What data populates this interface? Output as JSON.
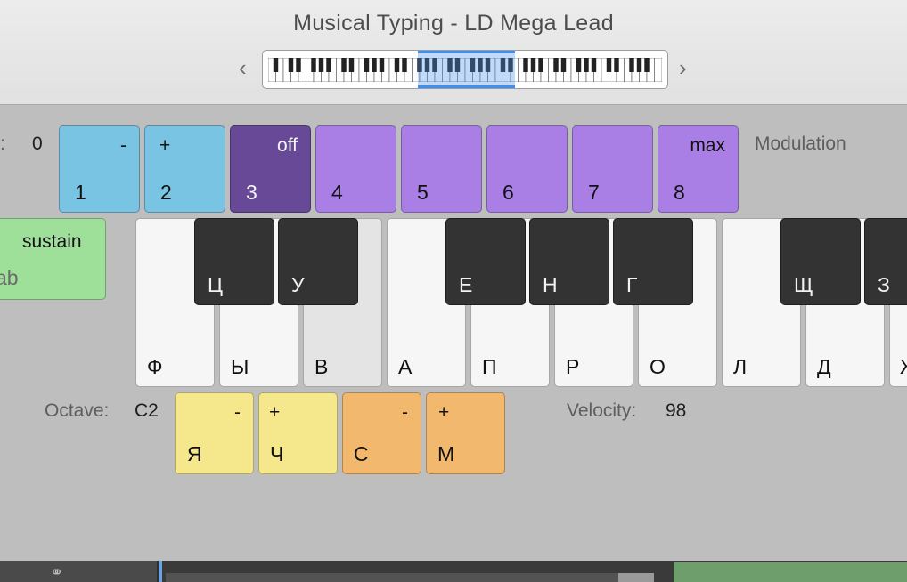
{
  "window": {
    "title": "Musical Typing - LD Mega Lead"
  },
  "navigation": {
    "prev_icon": "chevron-left-icon",
    "next_icon": "chevron-right-icon",
    "prev_glyph": "‹",
    "next_glyph": "›"
  },
  "pitch_bend": {
    "value": "0"
  },
  "pitch_keys": [
    {
      "symbol": "-",
      "key": "1"
    },
    {
      "symbol": "+",
      "key": "2"
    }
  ],
  "modulation_keys": [
    {
      "symbol": "off",
      "key": "3"
    },
    {
      "symbol": "",
      "key": "4"
    },
    {
      "symbol": "",
      "key": "5"
    },
    {
      "symbol": "",
      "key": "6"
    },
    {
      "symbol": "",
      "key": "7"
    },
    {
      "symbol": "max",
      "key": "8"
    }
  ],
  "modulation_label": "Modulation",
  "sustain": {
    "label": "sustain",
    "key": "ab"
  },
  "white_keys": [
    "Ф",
    "Ы",
    "В",
    "А",
    "П",
    "Р",
    "О",
    "Л",
    "Д",
    "Ж"
  ],
  "black_keys": [
    "Ц",
    "У",
    "Е",
    "Н",
    "Г",
    "Щ",
    "З"
  ],
  "octave": {
    "label": "Octave:",
    "value": "C2",
    "down": {
      "symbol": "-",
      "key": "Я"
    },
    "up": {
      "symbol": "+",
      "key": "Ч"
    }
  },
  "velocity": {
    "label": "Velocity:",
    "value": "98",
    "down": {
      "symbol": "-",
      "key": "С"
    },
    "up": {
      "symbol": "+",
      "key": "М"
    }
  },
  "bottom_bar": {
    "link_glyph": "⚭"
  },
  "colors": {
    "pitch": "#79c3e3",
    "modulation_off": "#674997",
    "modulation": "#a97fe6",
    "sustain": "#9edf99",
    "octave": "#f4e78c",
    "velocity": "#f2b96e",
    "selection": "#3f8ff0"
  }
}
